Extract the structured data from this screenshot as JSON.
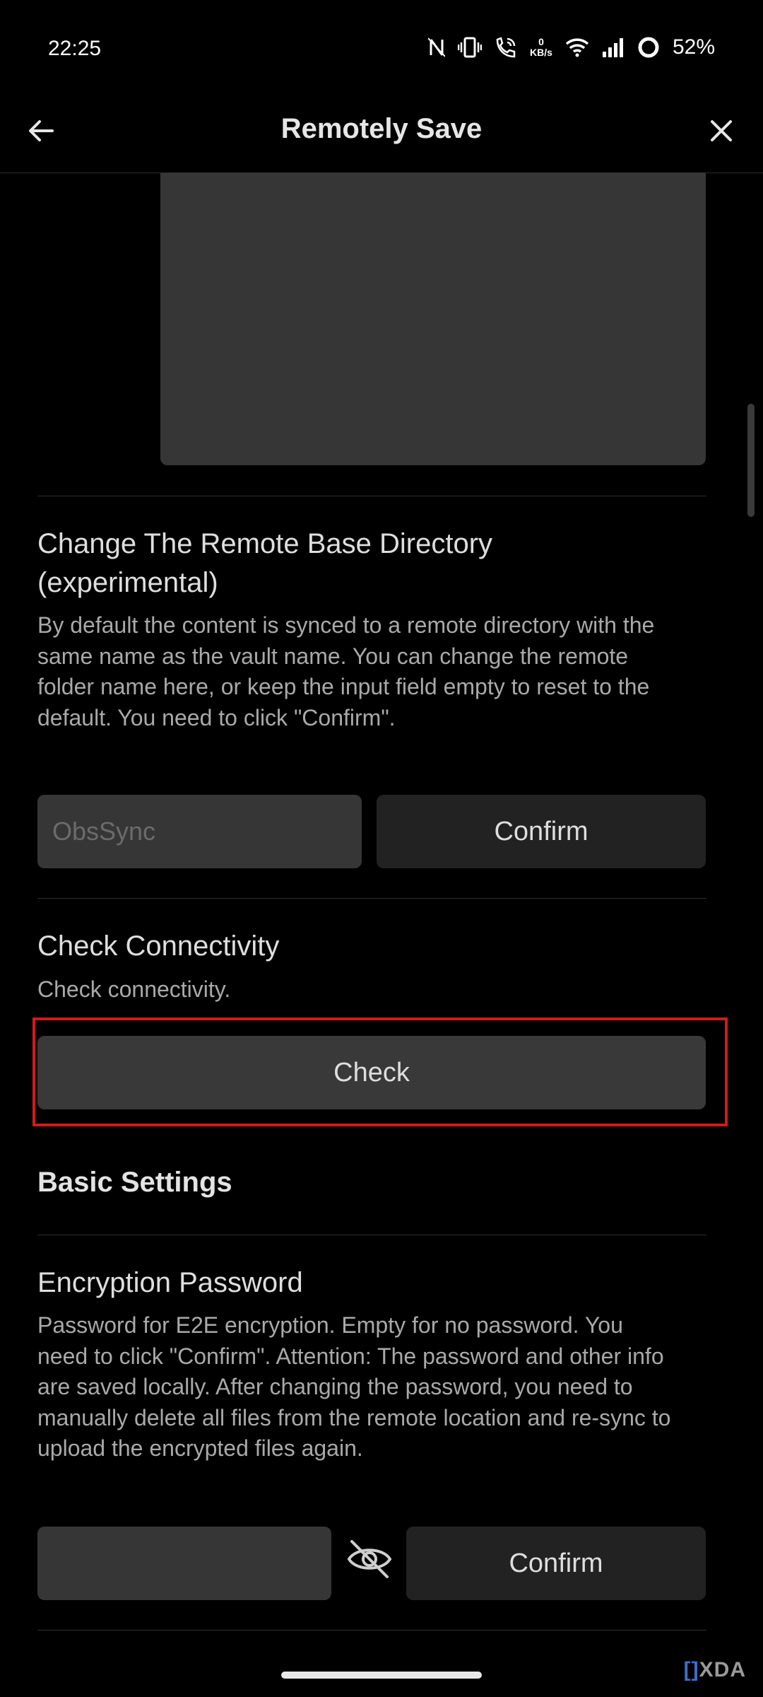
{
  "status_bar": {
    "time": "22:25",
    "network_speed_value": "0",
    "network_speed_unit": "KB/s",
    "battery": "52%",
    "icons": [
      "nfc-icon",
      "vibrate-icon",
      "wifi-calling-icon",
      "wifi-icon",
      "signal-icon",
      "battery-ring-icon"
    ]
  },
  "header": {
    "title": "Remotely Save",
    "back_icon": "arrow-left-icon",
    "close_icon": "close-icon"
  },
  "remote_base_dir": {
    "title": "Change The Remote Base Directory (experimental)",
    "description": "By default the content is synced to a remote directory with the same name as the vault name. You can change the remote folder name here, or keep the input field empty to reset to the default. You need to click \"Confirm\".",
    "input_placeholder": "ObsSync",
    "confirm_label": "Confirm"
  },
  "check_connectivity": {
    "title": "Check Connectivity",
    "description": "Check connectivity.",
    "button_label": "Check",
    "highlight_color": "#d21b1b"
  },
  "basic_settings": {
    "heading": "Basic Settings"
  },
  "encryption_password": {
    "title": "Encryption Password",
    "description": "Password for E2E encryption. Empty for no password. You need to click \"Confirm\". Attention: The password and other info are saved locally. After changing the password, you need to manually delete all files from the remote location and re-sync to upload the encrypted files again.",
    "input_value": "",
    "visibility_icon": "eye-off-icon",
    "confirm_label": "Confirm"
  },
  "watermark": {
    "bracket": "[]",
    "text": "XDA"
  }
}
